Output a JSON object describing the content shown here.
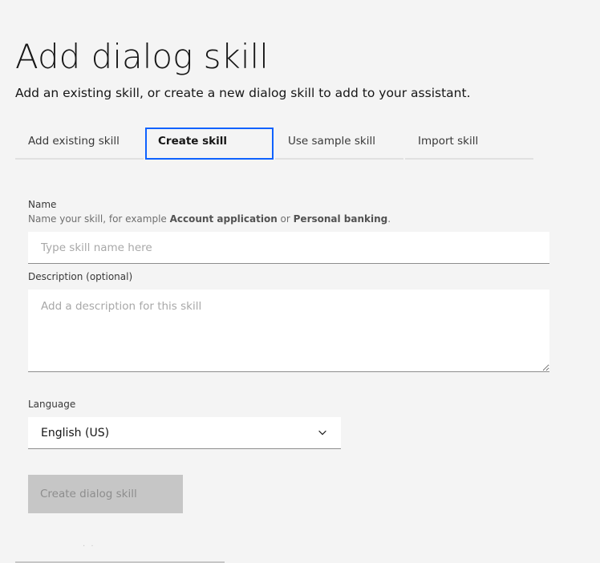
{
  "header": {
    "title": "Add dialog skill",
    "subtitle": "Add an existing skill, or create a new dialog skill to add to your assistant."
  },
  "tabs": [
    {
      "label": "Add existing skill",
      "selected": false
    },
    {
      "label": "Create skill",
      "selected": true
    },
    {
      "label": "Use sample skill",
      "selected": false
    },
    {
      "label": "Import skill",
      "selected": false
    }
  ],
  "form": {
    "name": {
      "label": "Name",
      "helper_prefix": "Name your skill, for example ",
      "helper_example1": "Account application",
      "helper_mid": " or ",
      "helper_example2": "Personal banking",
      "helper_suffix": ".",
      "value": "",
      "placeholder": "Type skill name here"
    },
    "description": {
      "label": "Description (optional)",
      "value": "",
      "placeholder": "Add a description for this skill"
    },
    "language": {
      "label": "Language",
      "selected": "English (US)",
      "icon": "chevron-down-icon"
    },
    "submit_label": "Create dialog skill",
    "submit_disabled": true
  },
  "colors": {
    "background": "#f4f4f4",
    "accent": "#0f62fe",
    "disabled_button": "#c6c6c6",
    "disabled_text": "#8d8d8d"
  }
}
